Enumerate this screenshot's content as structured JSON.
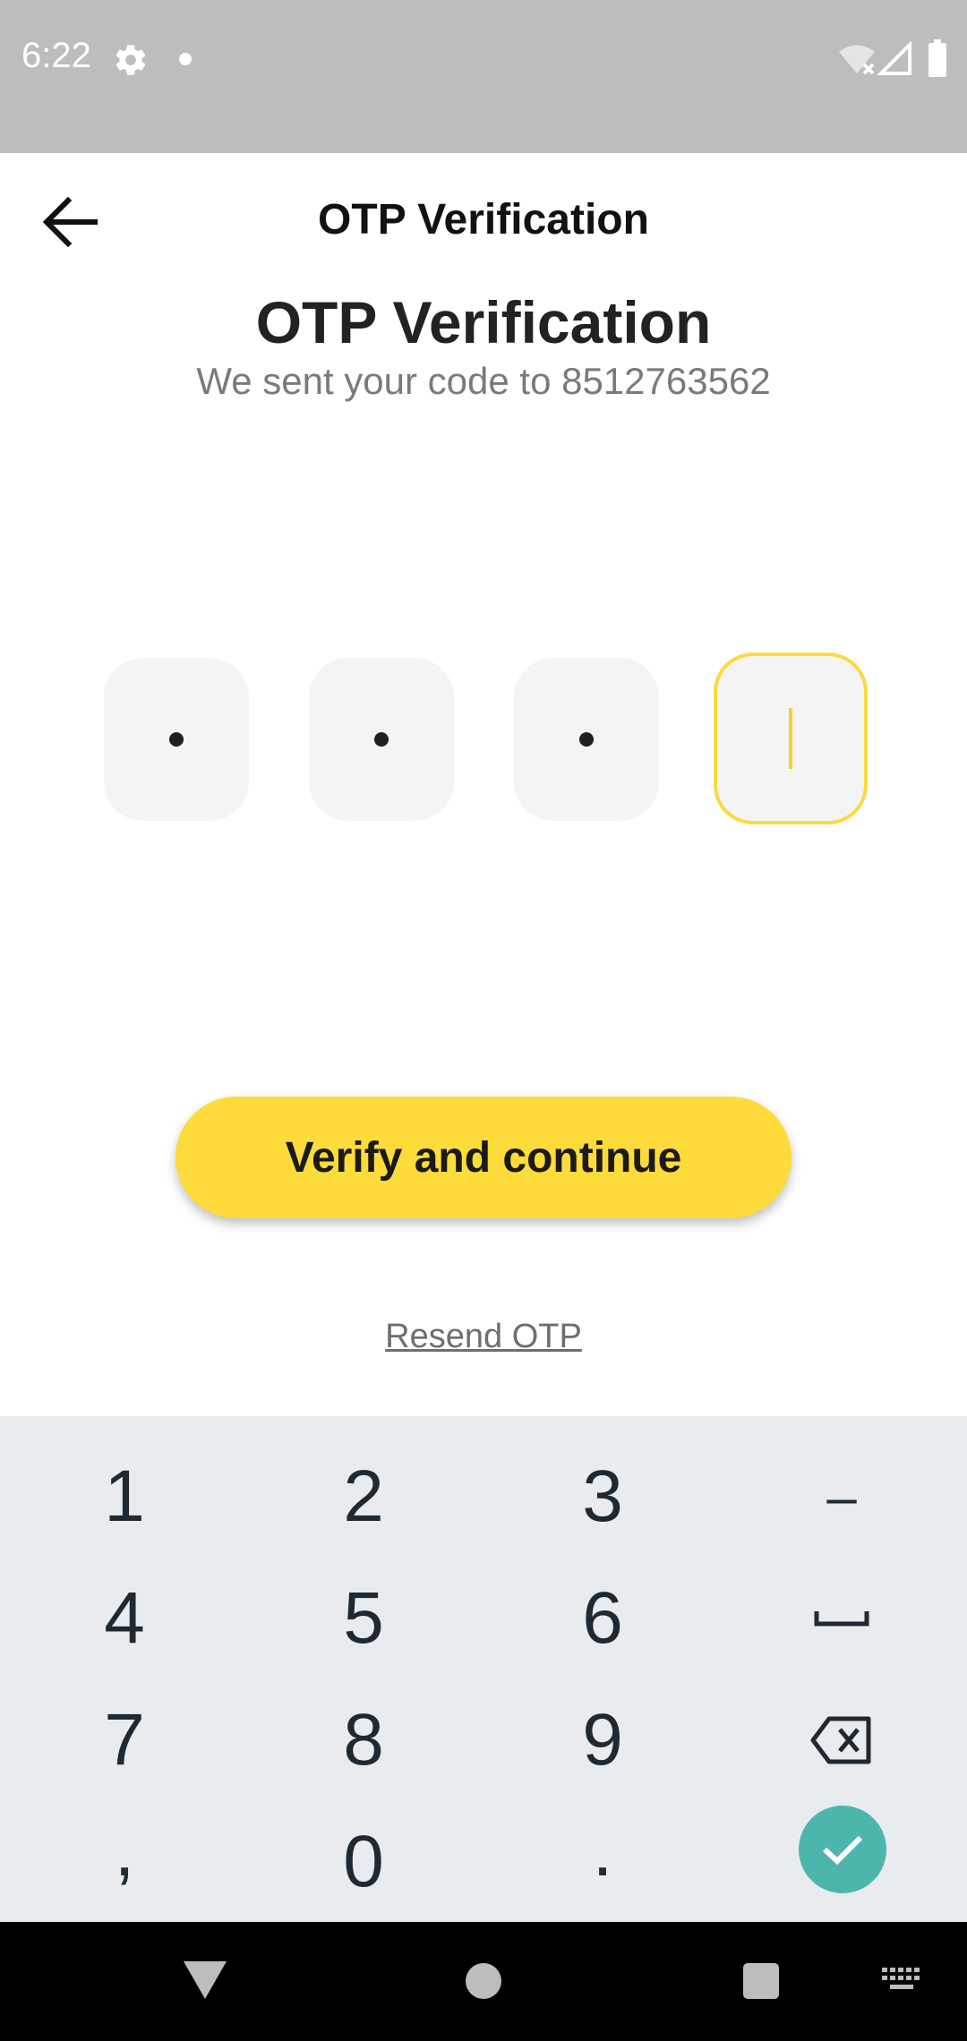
{
  "status_bar": {
    "time": "6:22",
    "icons": [
      "gear-icon",
      "notification-dot-icon",
      "wifi-off-icon",
      "signal-icon",
      "battery-icon"
    ]
  },
  "app_bar": {
    "title": "OTP Verification",
    "back_icon": "arrow-left-icon"
  },
  "main": {
    "title": "OTP Verification",
    "subtitle": "We sent your code to 8512763562",
    "otp": {
      "length": 4,
      "filled": 3,
      "active_index": 3
    },
    "verify_button": "Verify and continue",
    "resend_link": "Resend OTP"
  },
  "keyboard": {
    "rows": [
      [
        "1",
        "2",
        "3",
        "–"
      ],
      [
        "4",
        "5",
        "6",
        "space-icon"
      ],
      [
        "7",
        "8",
        "9",
        "backspace-icon"
      ],
      [
        ",",
        "0",
        ".",
        "check-icon"
      ]
    ]
  },
  "nav_bar": {
    "icons": [
      "back-triangle-icon",
      "home-circle-icon",
      "recents-square-icon",
      "keyboard-icon"
    ]
  },
  "colors": {
    "accent": "#fddb3a",
    "otp_box_bg": "#f4f4f4",
    "keyboard_bg": "#e9ecef",
    "keyboard_action": "#4db6ac",
    "status_bar_bg": "#bdbdbd"
  }
}
